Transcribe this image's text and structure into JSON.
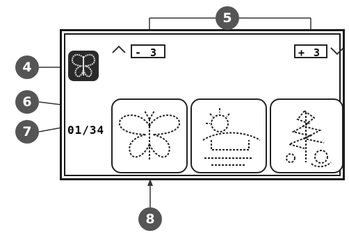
{
  "callouts": {
    "c4": "4",
    "c5": "5",
    "c6": "6",
    "c7": "7",
    "c8": "8"
  },
  "pager": {
    "prev_label": "- 3",
    "next_label": "+ 3",
    "counter": "01/34"
  },
  "columns": [
    "00",
    "01",
    "02"
  ],
  "selected_column": "00",
  "icons": {
    "thumb": "butterfly-thumbnail-icon",
    "up": "chevron-up-icon",
    "down": "chevron-down-icon"
  },
  "colors": {
    "frame": "#1a1a1a",
    "callout": "#555555"
  }
}
